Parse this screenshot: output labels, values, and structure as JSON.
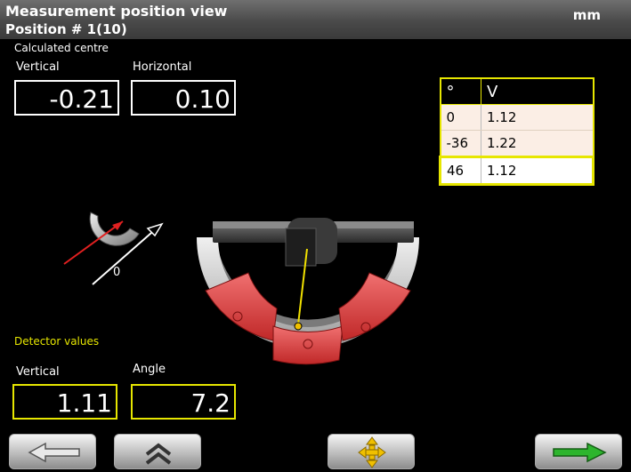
{
  "header": {
    "title": "Measurement position view",
    "position": "Position # 1(10)",
    "unit": "mm"
  },
  "calculated": {
    "section_label": "Calculated centre",
    "vertical_label": "Vertical",
    "vertical_value": "-0.21",
    "horizontal_label": "Horizontal",
    "horizontal_value": "0.10"
  },
  "table": {
    "headers": [
      "°",
      "V"
    ],
    "rows": [
      {
        "angle": "0",
        "v": "1.12"
      },
      {
        "angle": "-36",
        "v": "1.22"
      },
      {
        "angle": "46",
        "v": "1.12"
      }
    ]
  },
  "indicator": {
    "label": "0"
  },
  "detector": {
    "section_label": "Detector values",
    "vertical_label": "Vertical",
    "vertical_value": "1.11",
    "angle_label": "Angle",
    "angle_value": "7.2"
  },
  "icons": {
    "back": "left-arrow-icon",
    "up": "double-chevron-up-icon",
    "move": "move-arrows-icon",
    "next": "right-arrow-icon"
  },
  "colors": {
    "highlight": "#e6e600",
    "table_row": "#fbeee5",
    "next_arrow": "#2db52d",
    "sensor_red": "#e04848"
  }
}
